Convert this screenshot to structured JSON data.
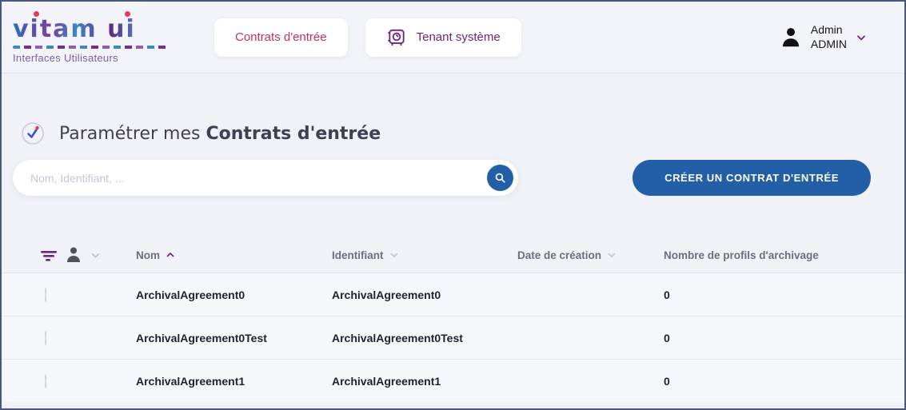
{
  "header": {
    "logo": {
      "brand": "vitam ui",
      "subtitle": "Interfaces Utilisateurs"
    },
    "nav": {
      "contracts_label": "Contrats d'entrée",
      "tenant_label": "Tenant système"
    },
    "user": {
      "first_name": "Admin",
      "last_name": "ADMIN"
    }
  },
  "main": {
    "title": {
      "prefix": "Paramétrer mes ",
      "emphasis": "Contrats d'entrée"
    },
    "search": {
      "placeholder": "Nom, Identifiant, ...",
      "value": ""
    },
    "create_button_label": "CRÉER UN CONTRAT D'ENTRÉE"
  },
  "table": {
    "columns": {
      "nom": "Nom",
      "identifiant": "Identifiant",
      "date_creation": "Date de création",
      "profils": "Nombre de profils d'archivage"
    },
    "sort": {
      "active_column": "Nom",
      "direction": "asc"
    },
    "rows": [
      {
        "status": "active",
        "nom": "ArchivalAgreement0",
        "identifiant": "ArchivalAgreement0",
        "date_creation": "",
        "profils": "0"
      },
      {
        "status": "active",
        "nom": "ArchivalAgreement0Test",
        "identifiant": "ArchivalAgreement0Test",
        "date_creation": "",
        "profils": "0"
      },
      {
        "status": "active",
        "nom": "ArchivalAgreement1",
        "identifiant": "ArchivalAgreement1",
        "date_creation": "",
        "profils": "0"
      }
    ]
  },
  "colors": {
    "primary_blue": "#225fa6",
    "accent_red": "#c3305c",
    "brand_purple": "#702382",
    "status_green": "#2e7d32",
    "frame_border": "#49587a"
  }
}
